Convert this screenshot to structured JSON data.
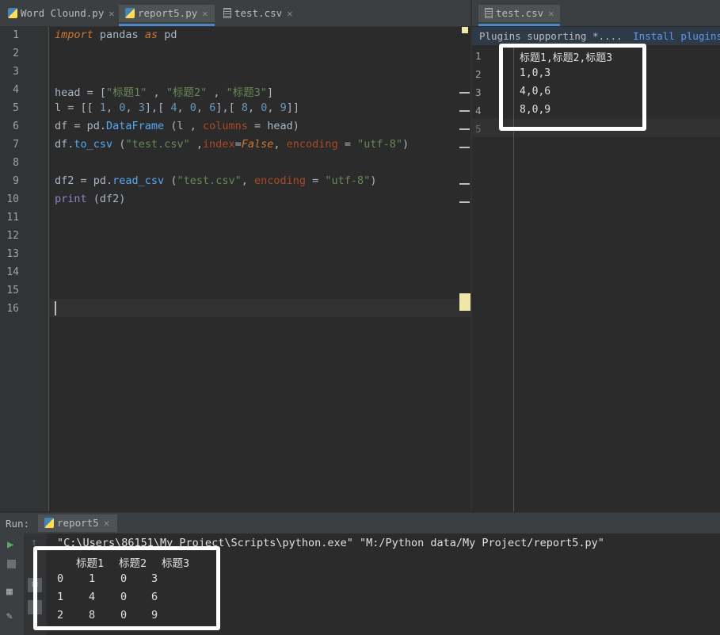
{
  "left_tabs": [
    {
      "label": "Word Clound.py",
      "type": "python",
      "active": false
    },
    {
      "label": "report5.py",
      "type": "python",
      "active": true
    },
    {
      "label": "test.csv",
      "type": "csv",
      "active": false
    }
  ],
  "right_tabs": [
    {
      "label": "test.csv",
      "type": "csv",
      "active": true
    }
  ],
  "right_banner": {
    "text": "Plugins supporting *....",
    "install_link": "Install plugins",
    "ignore_link": "I"
  },
  "left_editor": {
    "line_numbers": [
      "1",
      "2",
      "3",
      "4",
      "5",
      "6",
      "7",
      "8",
      "9",
      "10",
      "11",
      "12",
      "13",
      "14",
      "15",
      "16"
    ],
    "current_line": "16",
    "code_lines": [
      "import pandas as pd",
      "",
      "",
      "head = [\"标题1\" , \"标题2\" , \"标题3\"]",
      "l = [[ 1, 0, 3],[ 4, 0, 6],[ 8, 0, 9]]",
      "df = pd.DataFrame (l , columns = head)",
      "df.to_csv (\"test.csv\" ,index=False, encoding = \"utf-8\")",
      "",
      "df2 = pd.read_csv (\"test.csv\", encoding = \"utf-8\")",
      "print (df2)",
      "",
      "",
      "",
      "",
      "",
      ""
    ]
  },
  "right_editor": {
    "line_numbers": [
      "1",
      "2",
      "3",
      "4",
      "5"
    ],
    "lines": [
      "标题1,标题2,标题3",
      "1,0,3",
      "4,0,6",
      "8,0,9",
      ""
    ]
  },
  "run_panel": {
    "label": "Run:",
    "config_name": "report5",
    "command": "\"C:\\Users\\86151\\My Project\\Scripts\\python.exe\" \"M:/Python data/My Project/report5.py\"",
    "table_header": [
      "标题1",
      "标题2",
      "标题3"
    ],
    "table_rows": [
      {
        "index": "0",
        "cells": [
          "1",
          "0",
          "3"
        ]
      },
      {
        "index": "1",
        "cells": [
          "4",
          "0",
          "6"
        ]
      },
      {
        "index": "2",
        "cells": [
          "8",
          "0",
          "9"
        ]
      }
    ]
  },
  "colors": {
    "editor_bg": "#2b2b2b",
    "keyword": "#cc7832",
    "string": "#6a8759",
    "number": "#6897bb",
    "function": "#56a8f5",
    "param": "#aa4926",
    "highlight_box": "#ffffff"
  },
  "icons": {
    "python_file": "python-file-icon",
    "csv_file": "csv-file-icon",
    "run": "run-icon",
    "stop": "stop-icon",
    "up": "up-arrow-icon",
    "pin": "pin-icon",
    "layout": "layout-icon",
    "wrap": "soft-wrap-icon",
    "scroll": "scroll-end-icon"
  }
}
